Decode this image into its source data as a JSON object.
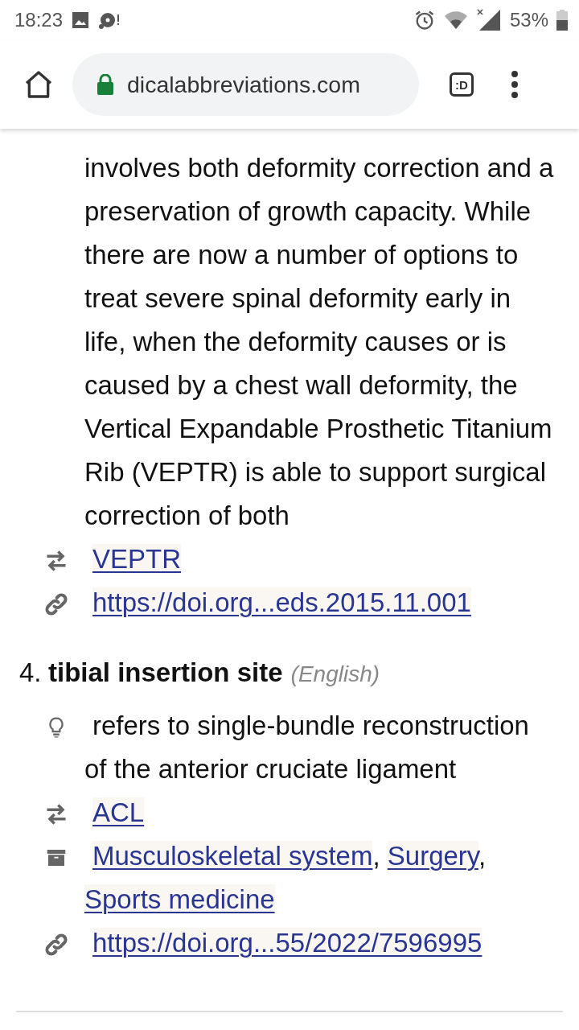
{
  "status_bar": {
    "time": "18:23",
    "battery": "53%"
  },
  "browser_toolbar": {
    "url": "dicalabbreviations.com",
    "tab_button": ":D"
  },
  "entries": [
    {
      "definition": "involves both deformity correction and a preservation of growth capacity. While there are now a number of options to treat severe spinal deformity early in life, when the deformity causes or is caused by a chest wall deformity, the Vertical Expandable Prosthetic Titanium Rib (VEPTR) is able to support surgical correction of both",
      "abbreviation": "VEPTR",
      "source_link": "https://doi.org...eds.2015.11.001"
    },
    {
      "number": "4.",
      "term": "tibial insertion site",
      "language": "(English)",
      "definition": "refers to single-bundle reconstruction of the anterior cruciate ligament",
      "abbreviation": "ACL",
      "categories": [
        "Musculoskeletal system",
        "Surgery",
        "Sports medicine"
      ],
      "separator": ",",
      "source_link": "https://doi.org...55/2022/7596995"
    }
  ]
}
